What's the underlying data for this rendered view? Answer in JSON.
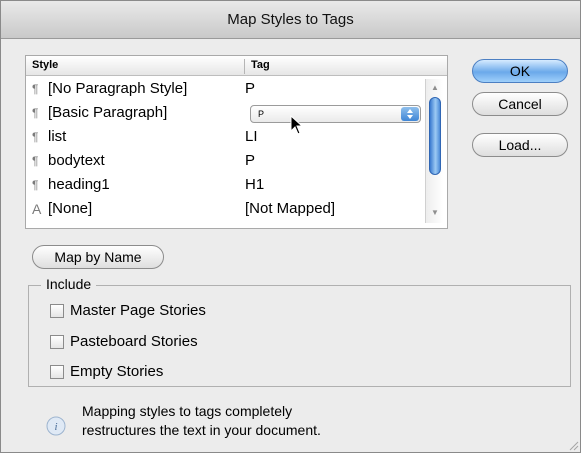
{
  "window": {
    "title": "Map Styles to Tags"
  },
  "table": {
    "headers": {
      "style": "Style",
      "tag": "Tag"
    },
    "rows": [
      {
        "icon": "paragraph-icon",
        "style": "[No Paragraph Style]",
        "tag": "P"
      },
      {
        "icon": "paragraph-icon",
        "style": "[Basic Paragraph]",
        "tag": "P",
        "editing": true
      },
      {
        "icon": "paragraph-icon",
        "style": "list",
        "tag": "LI"
      },
      {
        "icon": "paragraph-icon",
        "style": "bodytext",
        "tag": "P"
      },
      {
        "icon": "paragraph-icon",
        "style": "heading1",
        "tag": "H1"
      },
      {
        "icon": "character-style-icon",
        "style": "[None]",
        "tag": "[Not Mapped]"
      }
    ],
    "tag_select_value": "P"
  },
  "buttons": {
    "ok": "OK",
    "cancel": "Cancel",
    "load": "Load...",
    "map_by_name": "Map by Name"
  },
  "include": {
    "legend": "Include",
    "options": [
      {
        "label": "Master Page Stories",
        "checked": false
      },
      {
        "label": "Pasteboard Stories",
        "checked": false
      },
      {
        "label": "Empty Stories",
        "checked": false
      }
    ]
  },
  "info": {
    "icon": "info-icon",
    "line1": "Mapping styles to tags completely",
    "line2": "restructures the text in your document."
  },
  "colors": {
    "default_button": "#6ba9ea",
    "scroll_thumb": "#3a7ad0",
    "dialog_bg": "#ececec"
  }
}
